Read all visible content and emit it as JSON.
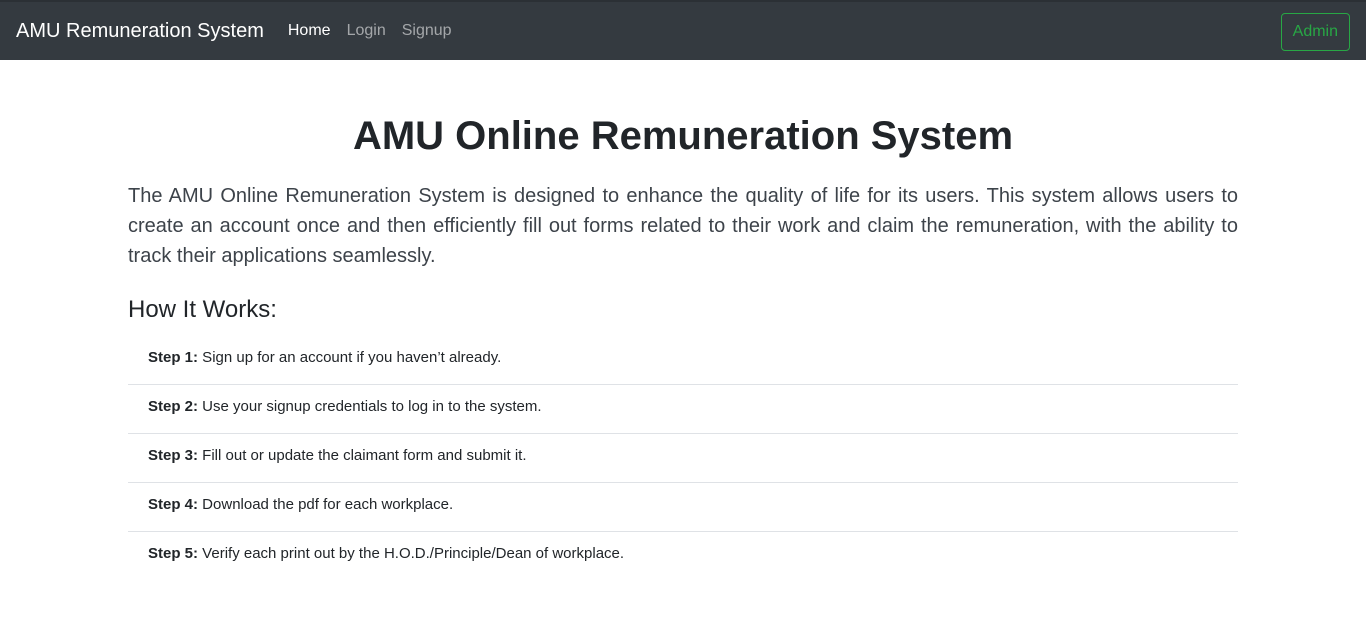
{
  "navbar": {
    "brand": "AMU Remuneration System",
    "links": [
      {
        "label": "Home"
      },
      {
        "label": "Login"
      },
      {
        "label": "Signup"
      }
    ],
    "admin_label": "Admin",
    "admin_color": "#28a745",
    "background": "#343a40"
  },
  "main": {
    "title": "AMU Online Remuneration System",
    "description": "The AMU Online Remuneration System is designed to enhance the quality of life for its users. This system allows users to create an account once and then efficiently fill out forms related to their work and claim the remuneration, with the ability to track their applications seamlessly.",
    "how_heading": "How It Works:",
    "steps": [
      {
        "label": "Step 1:",
        "text": " Sign up for an account if you haven’t already."
      },
      {
        "label": "Step 2:",
        "text": " Use your signup credentials to log in to the system."
      },
      {
        "label": "Step 3:",
        "text": " Fill out or update the claimant form and submit it."
      },
      {
        "label": "Step 4:",
        "text": " Download the pdf for each workplace."
      },
      {
        "label": "Step 5:",
        "text": " Verify each print out by the H.O.D./Principle/Dean of workplace."
      }
    ]
  }
}
